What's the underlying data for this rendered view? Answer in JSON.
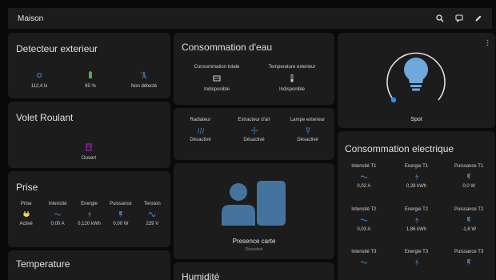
{
  "header": {
    "title": "Maison"
  },
  "detecteur": {
    "title": "Detecteur exterieur",
    "items": [
      {
        "icon": "brightness-icon",
        "value": "112,4 lx"
      },
      {
        "icon": "battery-icon",
        "value": "95 %"
      },
      {
        "icon": "motion-sensor-icon",
        "value": "Non détecté"
      }
    ]
  },
  "volet": {
    "title": "Volet Roulant",
    "state": "Ouvert",
    "icon": "blinds-icon"
  },
  "prise": {
    "title": "Prise",
    "columns": [
      {
        "label": "Prise",
        "value": "Activé",
        "icon": "power-plug-icon"
      },
      {
        "label": "Intensité",
        "value": "0,00 A",
        "icon": "current-icon"
      },
      {
        "label": "Energie",
        "value": "0,120 kWh",
        "icon": "energy-icon"
      },
      {
        "label": "Puissance",
        "value": "0,00 W",
        "icon": "power-icon"
      },
      {
        "label": "Tension",
        "value": "229 V",
        "icon": "voltage-icon"
      }
    ]
  },
  "temperature": {
    "title": "Temperature"
  },
  "eau": {
    "title": "Consommation d'eau",
    "items": [
      {
        "label": "Consommation totale",
        "value": "Indisponible",
        "icon": "water-meter-icon"
      },
      {
        "label": "Temperature exterieur",
        "value": "Indisponible",
        "icon": "thermometer-icon"
      }
    ]
  },
  "devices": {
    "items": [
      {
        "label": "Radiateur",
        "value": "Désactivé",
        "icon": "radiator-icon"
      },
      {
        "label": "Extracteur d'air",
        "value": "Désactivé",
        "icon": "fan-icon"
      },
      {
        "label": "Lampe exterieur",
        "value": "Désactivé",
        "icon": "outdoor-lamp-icon"
      }
    ]
  },
  "presence": {
    "name": "Presence carte",
    "state": "Désactivé"
  },
  "humidite": {
    "title": "Humidité"
  },
  "spot": {
    "name": "Spot",
    "brightness_fraction": 0.0
  },
  "electrique": {
    "title": "Consommation electrique",
    "rows": [
      {
        "labels": [
          "Intensité T1",
          "Energie T1",
          "Puissance T1"
        ],
        "values": [
          "0,02 A",
          "0,28 kWh",
          "0,0 W"
        ]
      },
      {
        "labels": [
          "Intensité T2",
          "Energie T2",
          "Puissance T2"
        ],
        "values": [
          "0,03 A",
          "1,86 kWh",
          "-1,8 W"
        ]
      },
      {
        "labels": [
          "Intensité T3",
          "Energie T3",
          "Puissance T3"
        ],
        "values": [
          "",
          "",
          ""
        ]
      }
    ]
  },
  "colors": {
    "accent": "#44739e",
    "blue": "#1e90ff",
    "bulb": "#6fa8dc",
    "yellow": "#fdd835",
    "purple": "#9c27b0",
    "green": "#4caf50"
  }
}
